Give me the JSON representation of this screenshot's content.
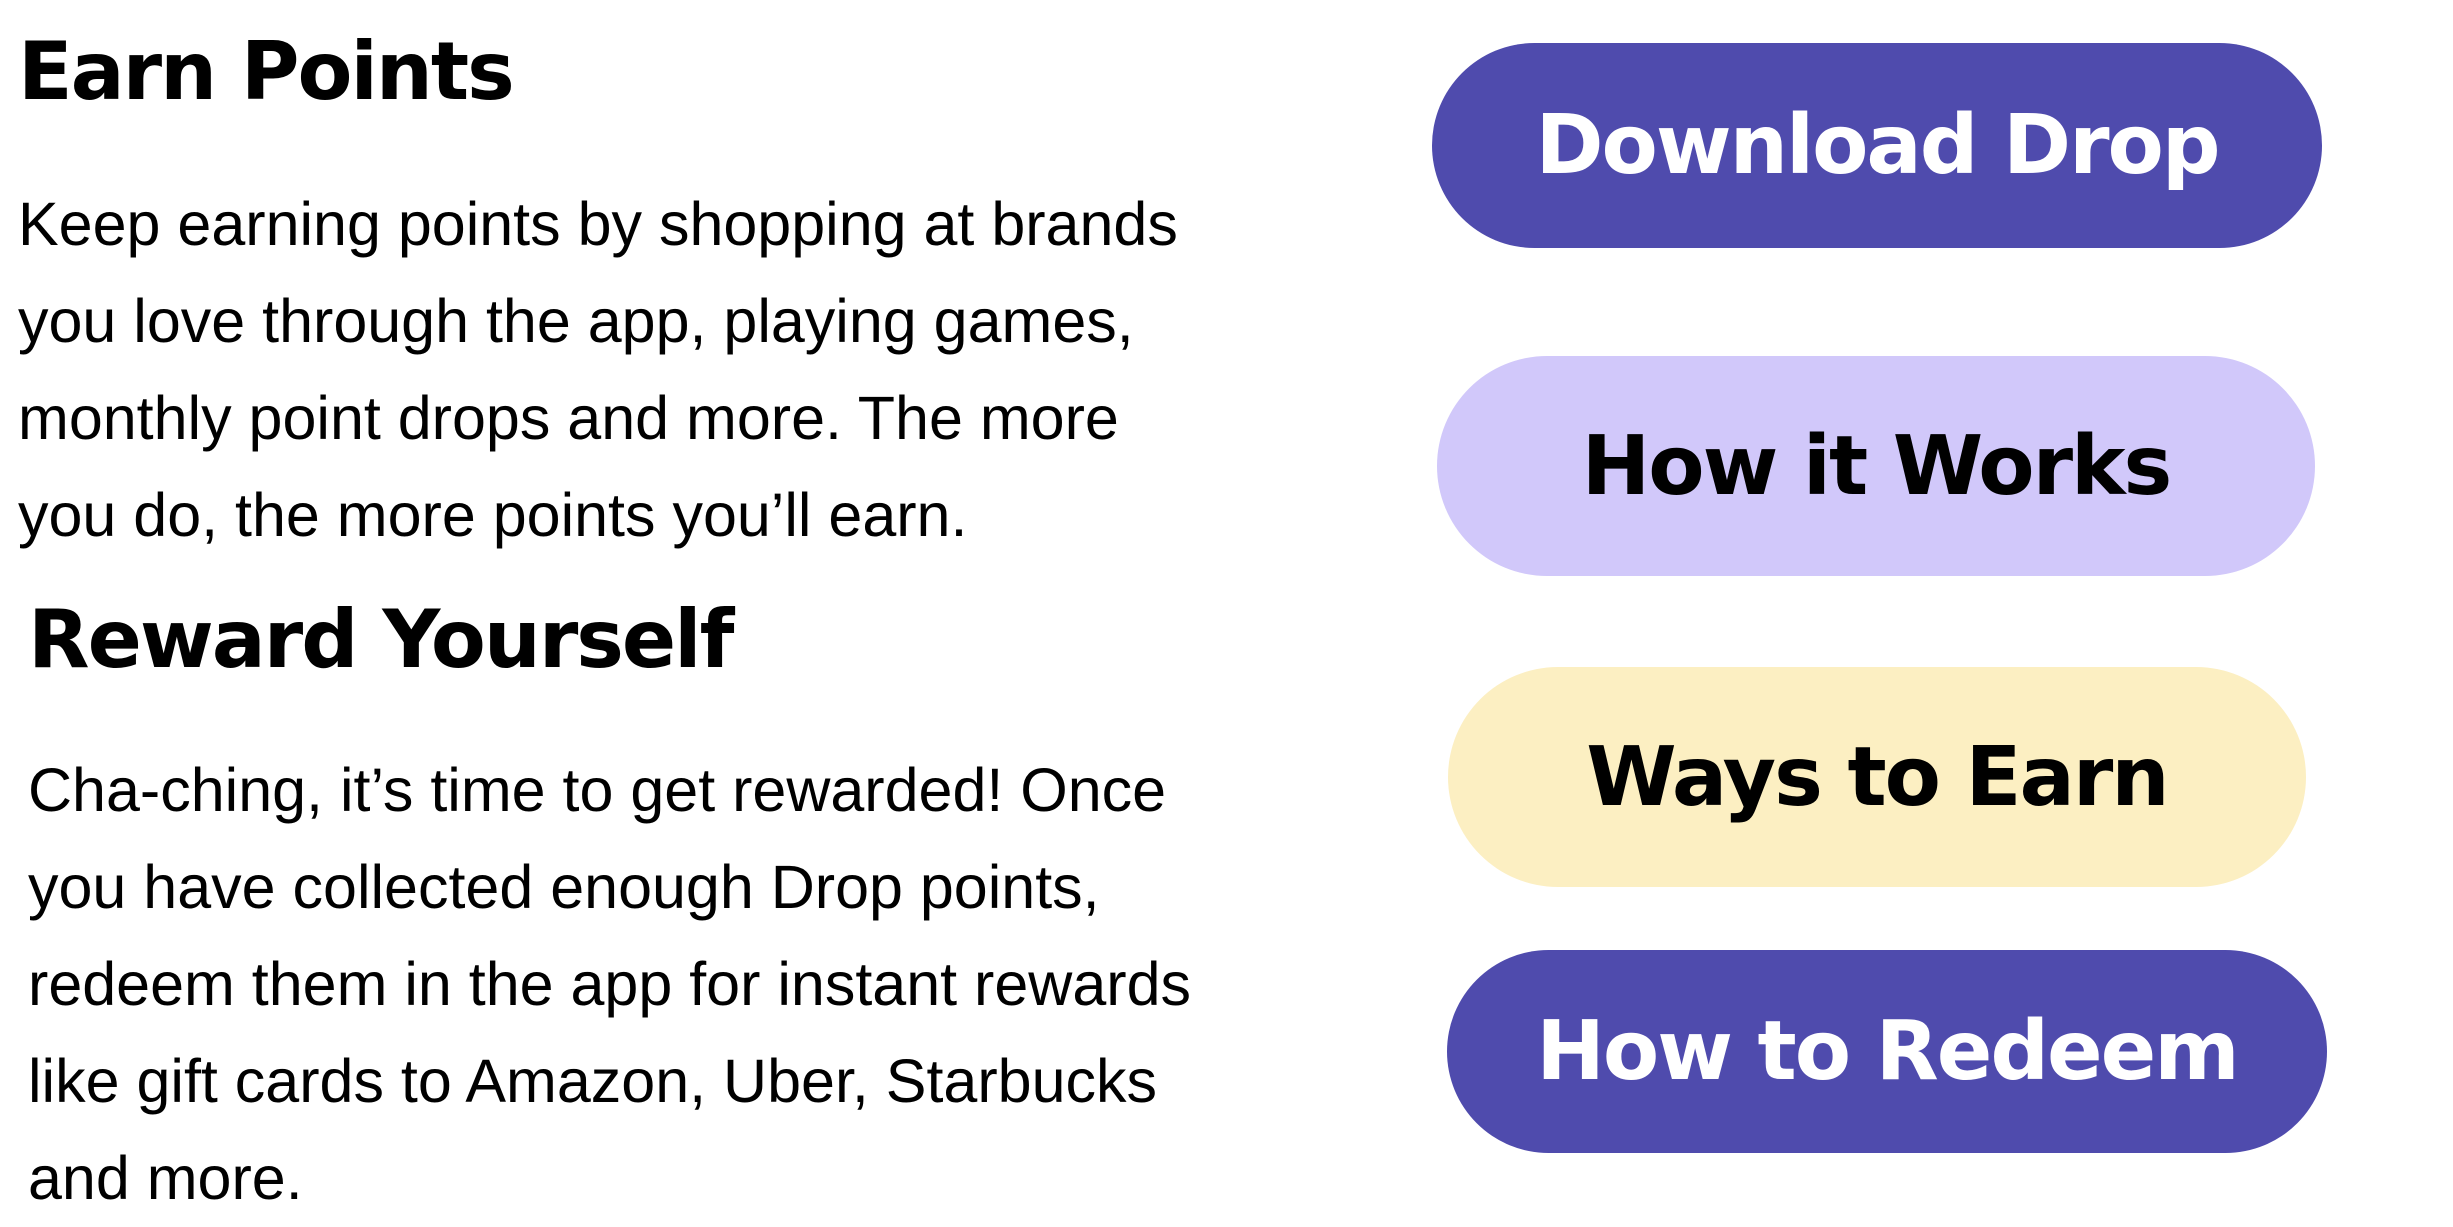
{
  "earn_points": {
    "title": "Earn Points",
    "body": "Keep earning points by shopping at brands\nyou love through the app, playing games,\nmonthly point drops and more. The more\nyou do, the more points you’ll earn."
  },
  "reward_yourself": {
    "title": "Reward Yourself",
    "body": "Cha-ching, it’s time to get rewarded! Once\nyou have collected enough Drop points,\nredeem them in the app for instant rewards\nlike gift cards to Amazon, Uber, Starbucks\nand more."
  },
  "buttons": [
    {
      "label": "Download Drop",
      "color": "#4f4bad",
      "text_color": "#ffffff"
    },
    {
      "label": "How it Works",
      "color": "#d1c8fa",
      "text_color": "#000000"
    },
    {
      "label": "Ways to Earn",
      "color": "#fcefc2",
      "text_color": "#000000"
    },
    {
      "label": "How to Redeem",
      "color": "#4f4bad",
      "text_color": "#ffffff"
    }
  ]
}
